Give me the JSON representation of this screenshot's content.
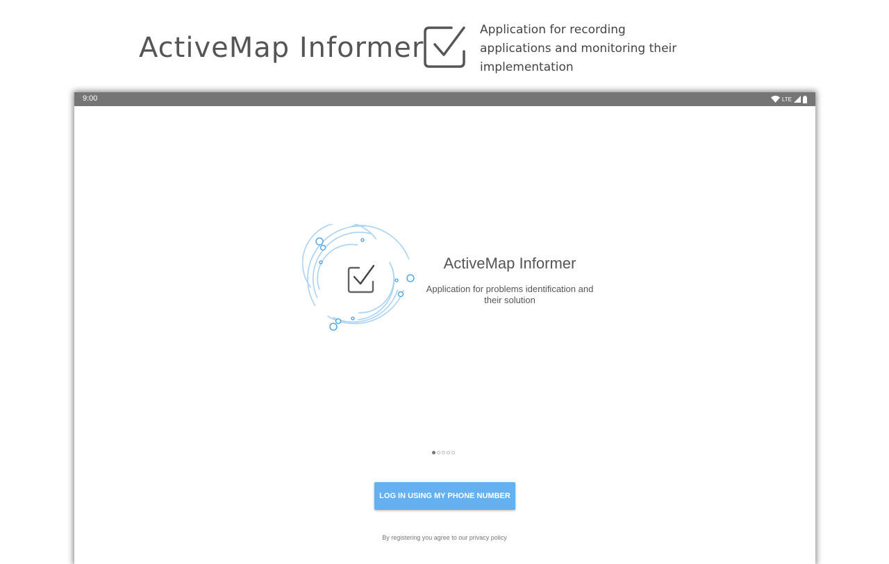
{
  "promo": {
    "title": "ActiveMap Informer",
    "tagline": "Application for recording applications and monitoring their implementation",
    "icon": "checkbox-icon"
  },
  "status_bar": {
    "time": "9:00",
    "network": "LTE",
    "icons": [
      "wifi-icon",
      "signal-icon",
      "battery-icon"
    ]
  },
  "onboarding": {
    "logo_icon": "checkbox-icon",
    "title": "ActiveMap Informer",
    "subtitle": "Application for problems identification and their solution",
    "page_indicator": {
      "current": 1,
      "total": 5
    }
  },
  "login_button": {
    "label": "LOG IN USING MY PHONE NUMBER"
  },
  "privacy_text": "By registering you agree to our privacy policy",
  "colors": {
    "accent": "#64b0f0",
    "logo_ring": "#a9d2f5",
    "logo_circle": "#3a9de6",
    "status_bar": "#757575",
    "text": "#555555"
  }
}
